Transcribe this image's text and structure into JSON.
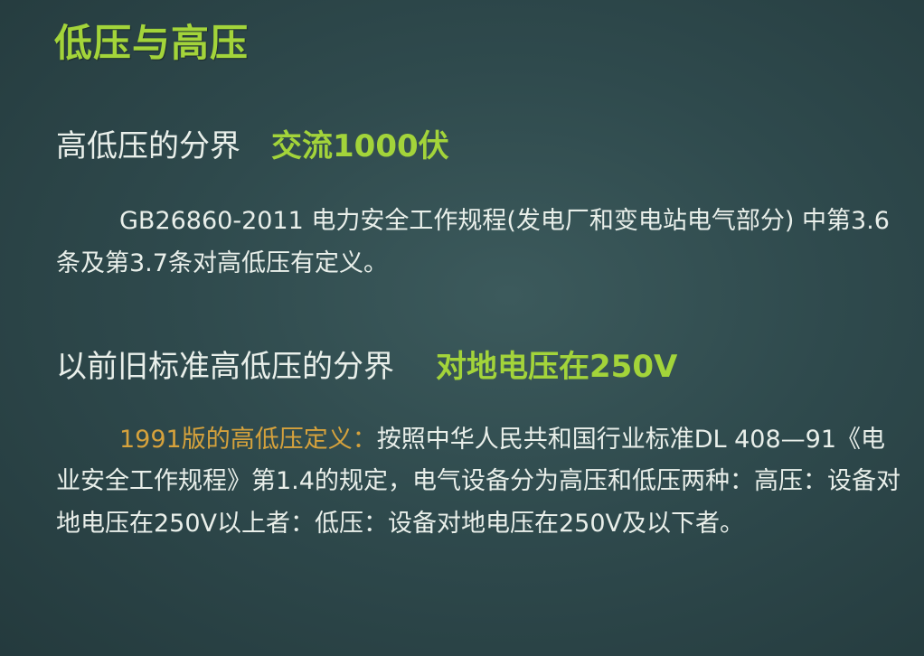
{
  "slide": {
    "title": "低压与高压",
    "section1": {
      "heading": "高低压的分界",
      "highlight": "交流1000伏",
      "paragraph": "GB26860-2011 电力安全工作规程(发电厂和变电站电气部分) 中第3.6条及第3.7条对高低压有定义。"
    },
    "section2": {
      "heading": "以前旧标准高低压的分界",
      "highlight": "对地电压在250V",
      "paragraph_lead": "1991版的高低压定义：",
      "paragraph_body": "按照中华人民共和国行业标准DL 408—91《电业安全工作规程》第1.4的规定，电气设备分为高压和低压两种：高压：设备对地电压在250V以上者：低压：设备对地电压在250V及以下者。"
    }
  },
  "colors": {
    "background": "#2f4a4d",
    "accent_green": "#a3d43a",
    "accent_orange": "#d6a23c",
    "text": "#e9efea"
  }
}
